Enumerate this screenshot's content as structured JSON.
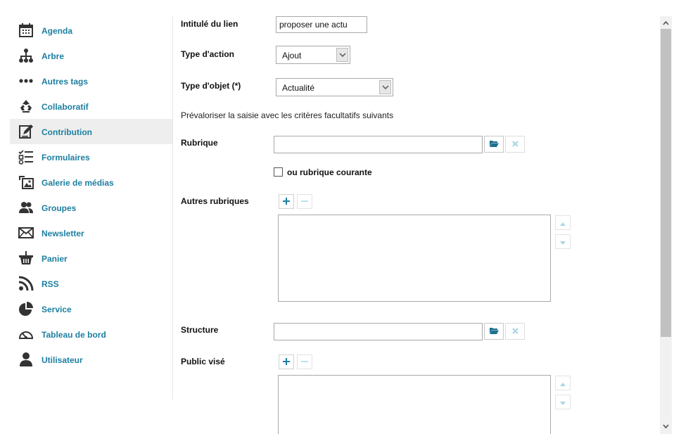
{
  "sidebar": {
    "items": [
      {
        "label": "Agenda",
        "icon": "calendar-icon",
        "active": false
      },
      {
        "label": "Arbre",
        "icon": "tree-icon",
        "active": false
      },
      {
        "label": "Autres tags",
        "icon": "dots-icon",
        "active": false
      },
      {
        "label": "Collaboratif",
        "icon": "recycle-arrows-icon",
        "active": false
      },
      {
        "label": "Contribution",
        "icon": "edit-icon",
        "active": true
      },
      {
        "label": "Formulaires",
        "icon": "checklist-icon",
        "active": false
      },
      {
        "label": "Galerie de médias",
        "icon": "media-gallery-icon",
        "active": false
      },
      {
        "label": "Groupes",
        "icon": "group-icon",
        "active": false
      },
      {
        "label": "Newsletter",
        "icon": "envelope-icon",
        "active": false
      },
      {
        "label": "Panier",
        "icon": "basket-icon",
        "active": false
      },
      {
        "label": "RSS",
        "icon": "rss-icon",
        "active": false
      },
      {
        "label": "Service",
        "icon": "pie-chart-icon",
        "active": false
      },
      {
        "label": "Tableau de bord",
        "icon": "gauge-icon",
        "active": false
      },
      {
        "label": "Utilisateur",
        "icon": "user-icon",
        "active": false
      }
    ]
  },
  "form": {
    "link_title": {
      "label": "Intitulé du lien",
      "value": "proposer une actu"
    },
    "action_type": {
      "label": "Type d'action",
      "value": "Ajout"
    },
    "object_type": {
      "label": "Type d'objet (*)",
      "value": "Actualité"
    },
    "prefill_text": "Prévaloriser la saisie avec les critères facultatifs suivants",
    "rubrique": {
      "label": "Rubrique",
      "value": ""
    },
    "current_rubrique": {
      "label": "ou rubrique courante",
      "checked": false
    },
    "other_rubriques": {
      "label": "Autres rubriques"
    },
    "structure": {
      "label": "Structure",
      "value": ""
    },
    "target_audience": {
      "label": "Public visé"
    }
  },
  "colors": {
    "accent": "#1d7fa0",
    "plus_button": "#1d7fa0",
    "disabled_icon": "#a9d6e5",
    "active_bg": "#eeeeee"
  }
}
